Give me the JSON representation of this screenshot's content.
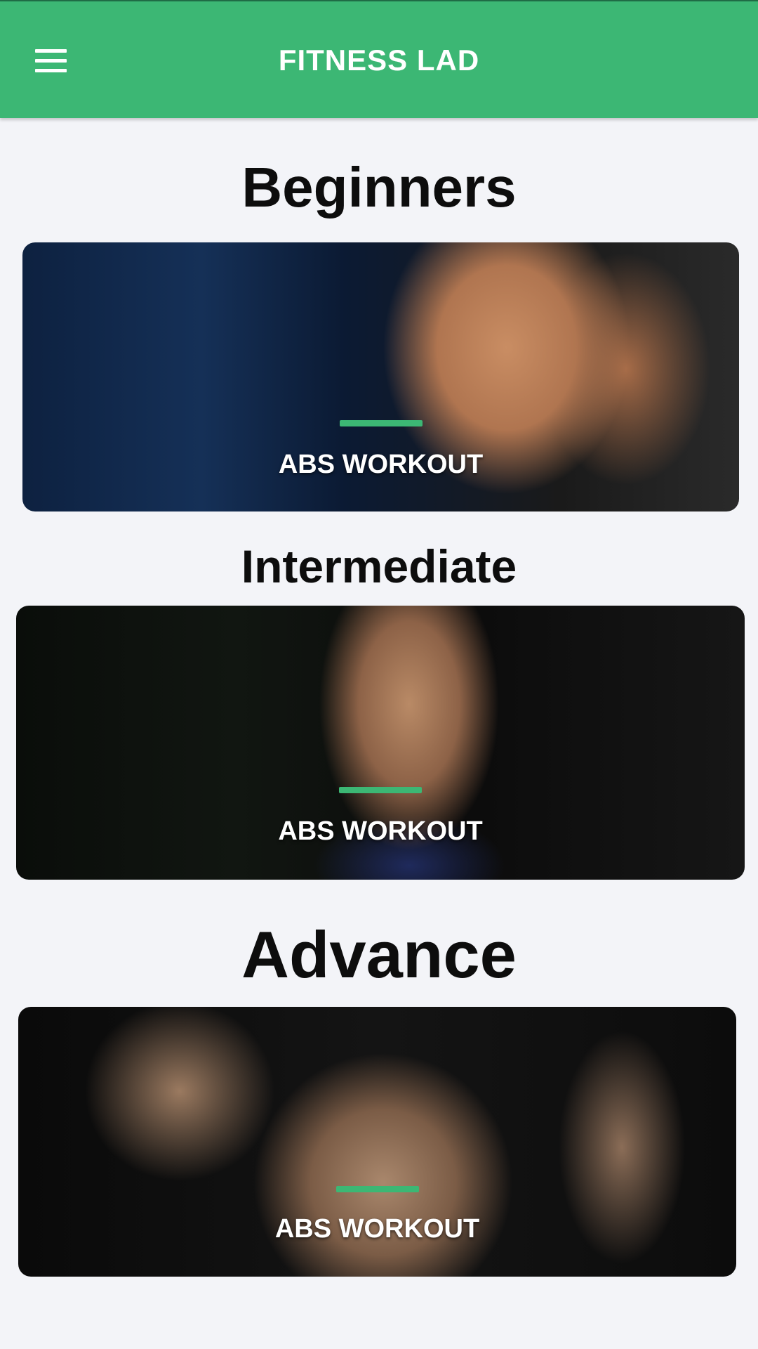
{
  "app_bar": {
    "title": "FITNESS LAD",
    "menu_icon": "hamburger-menu-icon",
    "background": "#3cb774"
  },
  "accent_color": "#3cb774",
  "sections": [
    {
      "title": "Beginners",
      "card": {
        "label": "ABS WORKOUT",
        "image": "shirtless man with abs in gym"
      }
    },
    {
      "title": "Intermediate",
      "card": {
        "label": "ABS WORKOUT",
        "image": "muscular torso six-pack in dark gym"
      }
    },
    {
      "title": "Advance",
      "card": {
        "label": "ABS WORKOUT",
        "image": "man lifting shirt showing abs"
      }
    }
  ]
}
